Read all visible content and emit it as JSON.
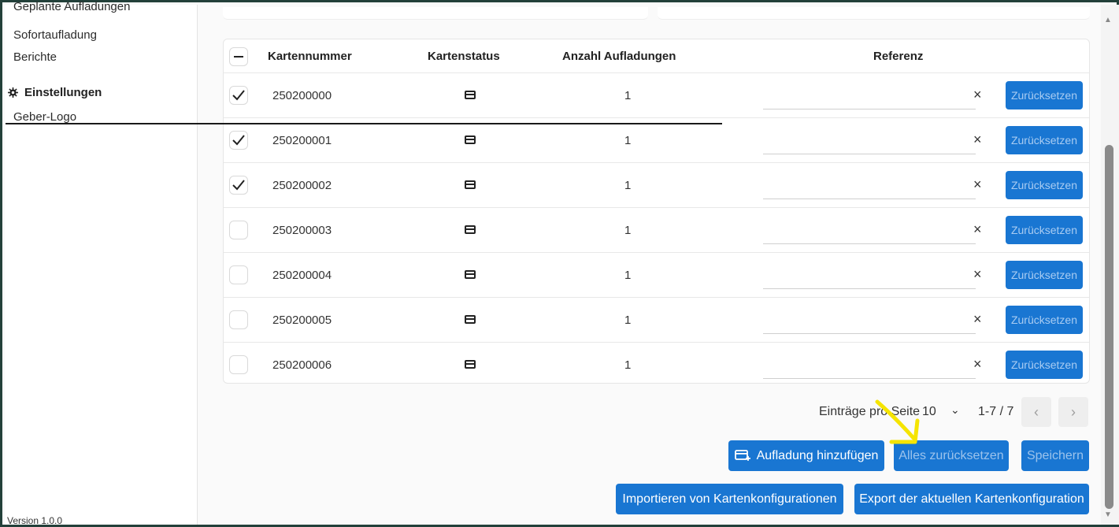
{
  "sidebar": {
    "items": [
      {
        "label": "Geplante Aufladungen"
      },
      {
        "label": "Sofortaufladung"
      },
      {
        "label": "Berichte"
      }
    ],
    "section_label": "Einstellungen",
    "sub_items": [
      {
        "label": "Geber-Logo"
      }
    ],
    "version": "Version 1.0.0"
  },
  "table": {
    "headers": {
      "card_number": "Kartennummer",
      "card_status": "Kartenstatus",
      "topup_count": "Anzahl Aufladungen",
      "reference": "Referenz"
    },
    "rows": [
      {
        "card_number": "250200000",
        "topup_count": "1",
        "checked": true,
        "reset_label": "Zurücksetzen"
      },
      {
        "card_number": "250200001",
        "topup_count": "1",
        "checked": true,
        "reset_label": "Zurücksetzen"
      },
      {
        "card_number": "250200002",
        "topup_count": "1",
        "checked": true,
        "reset_label": "Zurücksetzen"
      },
      {
        "card_number": "250200003",
        "topup_count": "1",
        "checked": false,
        "reset_label": "Zurücksetzen"
      },
      {
        "card_number": "250200004",
        "topup_count": "1",
        "checked": false,
        "reset_label": "Zurücksetzen"
      },
      {
        "card_number": "250200005",
        "topup_count": "1",
        "checked": false,
        "reset_label": "Zurücksetzen"
      },
      {
        "card_number": "250200006",
        "topup_count": "1",
        "checked": false,
        "reset_label": "Zurücksetzen"
      }
    ]
  },
  "pager": {
    "label": "Einträge pro Seite",
    "page_size": "10",
    "range": "1-7 / 7"
  },
  "actions": {
    "add_topup": "Aufladung hinzufügen",
    "reset_all": "Alles zurücksetzen",
    "save": "Speichern",
    "import": "Importieren von Kartenkonfigurationen",
    "export": "Export der aktuellen Kartenkonfiguration"
  },
  "colors": {
    "primary": "#1976d2",
    "annotation": "#f5e400",
    "frame": "#23403a"
  }
}
